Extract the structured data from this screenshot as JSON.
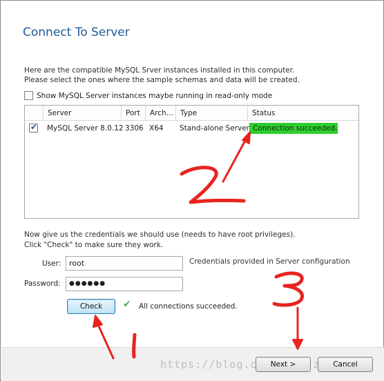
{
  "page": {
    "title": "Connect To Server"
  },
  "intro": {
    "line1": "Here are the compatible MySQL Srver instances installed in this computer.",
    "line2": "Please select the ones where the sample schemas and data will be created."
  },
  "readonly_option": {
    "label": "Show MySQL Server instances maybe running in read-only mode",
    "checked": false
  },
  "servers_table": {
    "columns": [
      "Server",
      "Port",
      "Arch...",
      "Type",
      "Status"
    ],
    "rows": [
      {
        "checked": true,
        "server": "MySQL Server 8.0.12",
        "port": "3306",
        "arch": "X64",
        "type": "Stand-alone Server",
        "status": "Connection succeeded."
      }
    ]
  },
  "credentials": {
    "line1": "Now give us the credentials we should use (needs to have root privileges).",
    "line2": "Click \"Check\" to make sure they work.",
    "user_label": "User:",
    "user_value": "root",
    "password_label": "Password:",
    "password_value": "●●●●●●",
    "hint": "Credentials provided in Server configuration"
  },
  "check": {
    "button_label": "Check",
    "result": "All connections succeeded."
  },
  "footer": {
    "next_label": "Next >",
    "cancel_label": "Cancel"
  },
  "watermark": "https://blog.csdn.net/zhou1007",
  "colors": {
    "title": "#1f5a9a",
    "status_ok": "#2fce2f",
    "annotation": "#e8231f"
  }
}
